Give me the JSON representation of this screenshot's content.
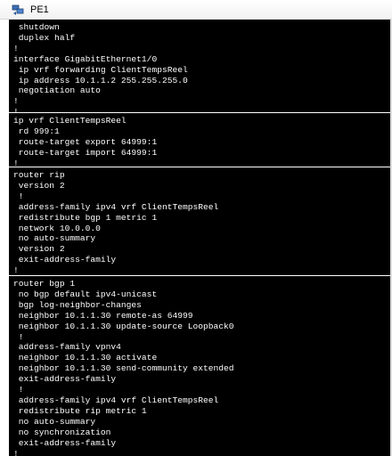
{
  "window": {
    "title": "PE1",
    "icon": "terminal-session-icon"
  },
  "config": {
    "text": "shutdown\nduplex half\n!\ninterface GigabitEthernet1/0\nip vrf forwarding ClientTempsReel\nip address 10.1.1.2 255.255.255.0\nnegotiation auto\n!\n!\nip vrf ClientTempsReel\nrd 999:1\nroute-target export 64999:1\nroute-target import 64999:1\n!\n!\nrouter rip\nversion 2\n!\naddress-family ipv4 vrf ClientTempsReel\nredistribute bgp 1 metric 1\nnetwork 10.0.0.0\nno auto-summary\nversion 2\nexit-address-family\n!\nrouter bgp 1\nno bgp default ipv4-unicast\nbgp log-neighbor-changes\nneighbor 10.1.1.30 remote-as 64999\nneighbor 10.1.1.30 update-source Loopback0\n!\naddress-family vpnv4\nneighbor 10.1.1.30 activate\nneighbor 10.1.1.30 send-community extended\nexit-address-family\n!\naddress-family ipv4 vrf ClientTempsReel\nredistribute rip metric 1\nno auto-summary\nno synchronization\nexit-address-family\n!",
    "lines": [
      " shutdown",
      " duplex half",
      "!",
      "interface GigabitEthernet1/0",
      " ip vrf forwarding ClientTempsReel",
      " ip address 10.1.1.2 255.255.255.0",
      " negotiation auto",
      "!",
      "!",
      "ip vrf ClientTempsReel",
      " rd 999:1",
      " route-target export 64999:1",
      " route-target import 64999:1",
      "!",
      "!",
      "router rip",
      " version 2",
      " !",
      " address-family ipv4 vrf ClientTempsReel",
      " redistribute bgp 1 metric 1",
      " network 10.0.0.0",
      " no auto-summary",
      " version 2",
      " exit-address-family",
      "!",
      "router bgp 1",
      " no bgp default ipv4-unicast",
      " bgp log-neighbor-changes",
      " neighbor 10.1.1.30 remote-as 64999",
      " neighbor 10.1.1.30 update-source Loopback0",
      " !",
      " address-family vpnv4",
      " neighbor 10.1.1.30 activate",
      " neighbor 10.1.1.30 send-community extended",
      " exit-address-family",
      " !",
      " address-family ipv4 vrf ClientTempsReel",
      " redistribute rip metric 1",
      " no auto-summary",
      " no synchronization",
      " exit-address-family",
      "!"
    ],
    "panels": [
      {
        "name": "interface-config-panel",
        "start": 0,
        "end": 8
      },
      {
        "name": "vrf-config-panel",
        "start": 9,
        "end": 14
      },
      {
        "name": "rip-config-panel",
        "start": 15,
        "end": 24
      },
      {
        "name": "bgp-config-panel",
        "start": 25,
        "end": 41
      }
    ]
  }
}
